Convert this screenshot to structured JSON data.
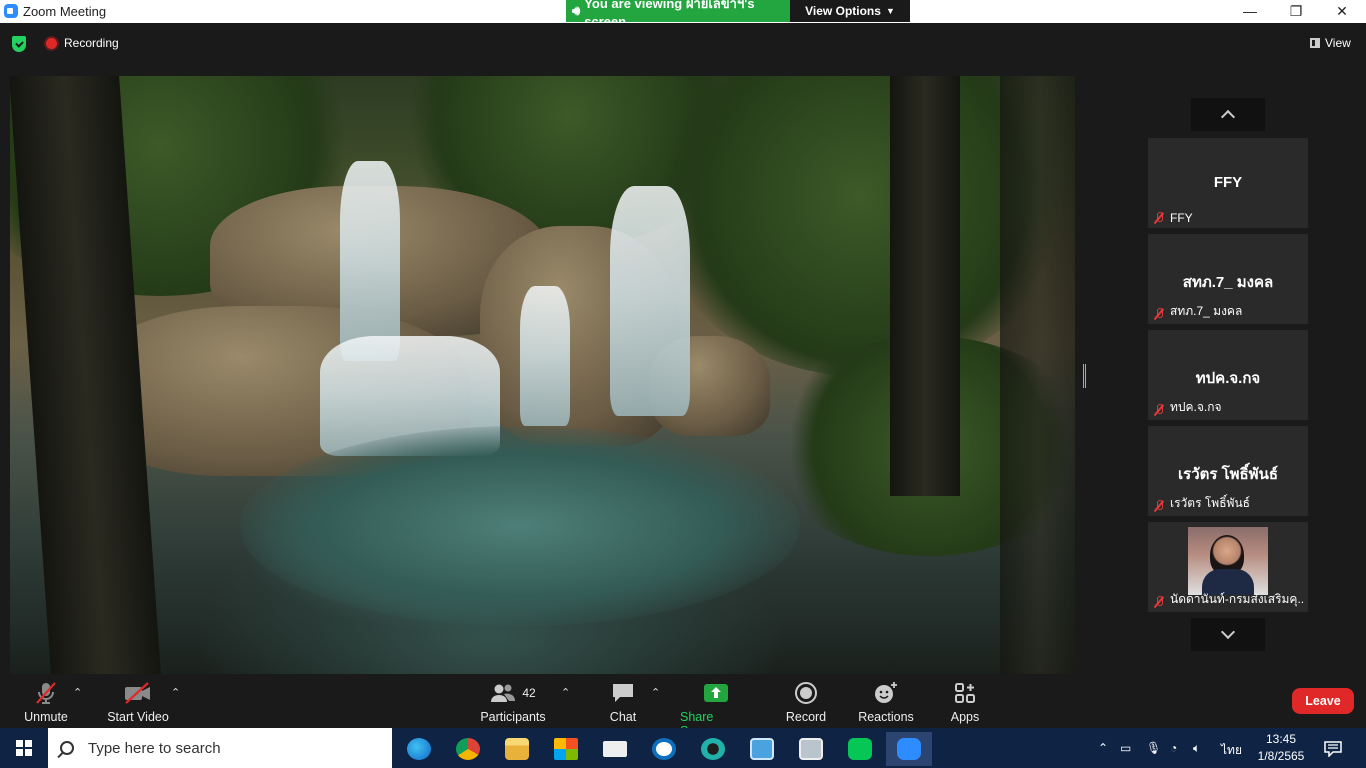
{
  "window": {
    "title": "Zoom Meeting",
    "viewing_banner": "You are viewing ฝ่ายเลขาฯ's screen",
    "view_options": "View Options",
    "minimize": "—",
    "maximize": "❐",
    "close": "✕"
  },
  "meeting_header": {
    "recording_label": "Recording",
    "view_label": "View"
  },
  "participants_panel": {
    "tiles": [
      {
        "display_name": "FFY",
        "caption": "FFY",
        "muted": true
      },
      {
        "display_name": "สทภ.7_ มงคล",
        "caption": "สทภ.7_ มงคล",
        "muted": true
      },
      {
        "display_name": "ทปค.จ.กจ",
        "caption": "ทปค.จ.กจ",
        "muted": true
      },
      {
        "display_name": "เรวัตร โพธิ์พันธ์",
        "caption": "เรวัตร โพธิ์พันธ์",
        "muted": true
      },
      {
        "display_name": "",
        "caption": "นัดดานันท์-กรมส่งเสริมคุ...",
        "muted": true,
        "video": true
      }
    ]
  },
  "toolbar": {
    "unmute": "Unmute",
    "start_video": "Start Video",
    "participants": "Participants",
    "participants_count": "42",
    "chat": "Chat",
    "share_screen": "Share Screen",
    "record": "Record",
    "reactions": "Reactions",
    "apps": "Apps",
    "leave": "Leave"
  },
  "taskbar": {
    "search_placeholder": "Type here to search",
    "language": "ไทย",
    "time": "13:45",
    "date": "1/8/2565",
    "apps": [
      "edge-icon",
      "chrome-icon",
      "file-explorer-icon",
      "store-icon",
      "mail-icon",
      "skype-icon",
      "webex-icon",
      "remote-desktop-icon",
      "photos-icon",
      "line-icon",
      "zoom-icon"
    ]
  },
  "colors": {
    "accent_green": "#23a540",
    "leave_red": "#e02828",
    "zoom_blue": "#2d8cff",
    "taskbar": "#0f2445"
  }
}
